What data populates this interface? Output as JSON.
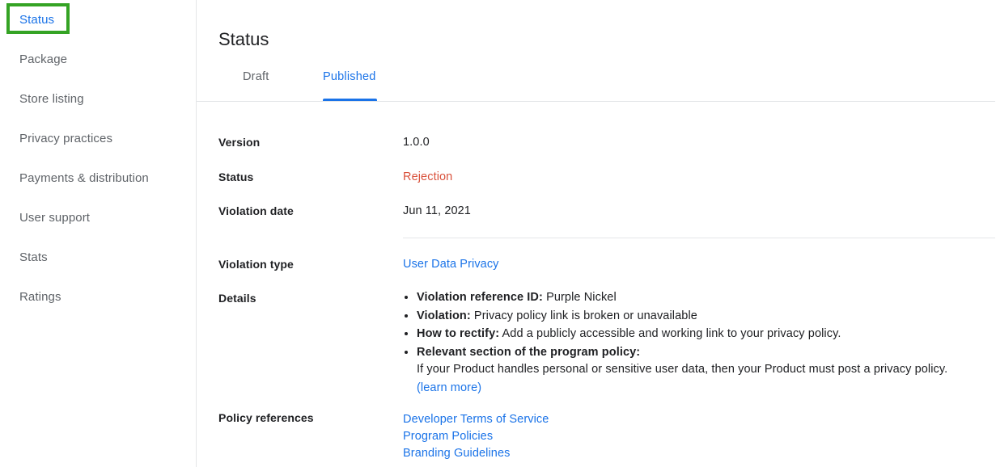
{
  "sidebar": {
    "items": [
      {
        "label": "Status",
        "active": true
      },
      {
        "label": "Package",
        "active": false
      },
      {
        "label": "Store listing",
        "active": false
      },
      {
        "label": "Privacy practices",
        "active": false
      },
      {
        "label": "Payments & distribution",
        "active": false
      },
      {
        "label": "User support",
        "active": false
      },
      {
        "label": "Stats",
        "active": false
      },
      {
        "label": "Ratings",
        "active": false
      }
    ],
    "highlight_color": "#34a324"
  },
  "main": {
    "title": "Status",
    "tabs": [
      {
        "label": "Draft",
        "selected": false
      },
      {
        "label": "Published",
        "selected": true
      }
    ],
    "accent_color": "#1a73e8",
    "rows": {
      "version": {
        "label": "Version",
        "value": "1.0.0"
      },
      "status": {
        "label": "Status",
        "value": "Rejection",
        "color": "#d9513b"
      },
      "violation_date": {
        "label": "Violation date",
        "value": "Jun 11, 2021"
      },
      "violation_type": {
        "label": "Violation type",
        "value": "User Data Privacy"
      },
      "details": {
        "label": "Details",
        "bullets": [
          {
            "term": "Violation reference ID:",
            "text": " Purple Nickel"
          },
          {
            "term": "Violation:",
            "text": " Privacy policy link is broken or unavailable"
          },
          {
            "term": "How to rectify:",
            "text": " Add a publicly accessible and working link to your privacy policy."
          },
          {
            "term": "Relevant section of the program policy:",
            "text": ""
          }
        ],
        "sub_text": "If your Product handles personal or sensitive user data, then your Product must post a privacy policy.",
        "sub_link": "(learn more)"
      },
      "policy_references": {
        "label": "Policy references",
        "links": [
          "Developer Terms of Service",
          "Program Policies",
          "Branding Guidelines"
        ]
      }
    }
  }
}
